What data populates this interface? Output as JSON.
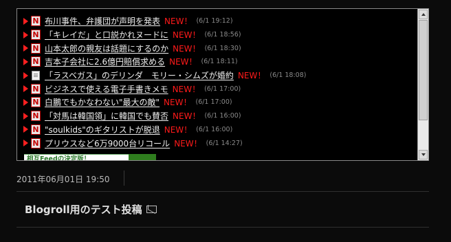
{
  "feed": {
    "items": [
      {
        "title": "布川事件、弁護団が声明を発表",
        "badge": "NEW！",
        "time": "(6/1 19:12)",
        "icon": "n-icon"
      },
      {
        "title": "「キレイだ」と口説かれヌードに",
        "badge": "NEW！",
        "time": "(6/1 18:56)",
        "icon": "n-icon"
      },
      {
        "title": "山本太郎の親友は話題にするのか",
        "badge": "NEW！",
        "time": "(6/1 18:30)",
        "icon": "n-icon"
      },
      {
        "title": "吉本子会社に2.6億円賠償求める",
        "badge": "NEW！",
        "time": "(6/1 18:11)",
        "icon": "n-icon"
      },
      {
        "title": "「ラスベガス」のデリンダ　モリー・シムズが婚約",
        "badge": "NEW！",
        "time": "(6/1 18:08)",
        "icon": "document-icon"
      },
      {
        "title": "ビジネスで使える電子手書きメモ",
        "badge": "NEW！",
        "time": "(6/1 17:00)",
        "icon": "n-icon"
      },
      {
        "title": "白鵬でもかなわない\"最大の敵\"",
        "badge": "NEW！",
        "time": "(6/1 17:00)",
        "icon": "n-icon"
      },
      {
        "title": "「対馬は韓国領」に韓国でも賛否",
        "badge": "NEW！",
        "time": "(6/1 16:00)",
        "icon": "n-icon"
      },
      {
        "title": "\"soulkids\"のギタリストが脱退",
        "badge": "NEW！",
        "time": "(6/1 16:00)",
        "icon": "n-icon"
      },
      {
        "title": "プリウスなど6万9000台リコール",
        "badge": "NEW！",
        "time": "(6/1 14:27)",
        "icon": "n-icon"
      }
    ],
    "banner_text": "相互Feedの決定版！"
  },
  "post": {
    "date": "2011年06月01日 19:50",
    "title": "Blogroll用のテスト投稿"
  },
  "colors": {
    "background": "#0b0b0b",
    "new_badge": "#ff1a1a",
    "bullet": "#ff2020",
    "timestamp": "#8a8a8a"
  }
}
